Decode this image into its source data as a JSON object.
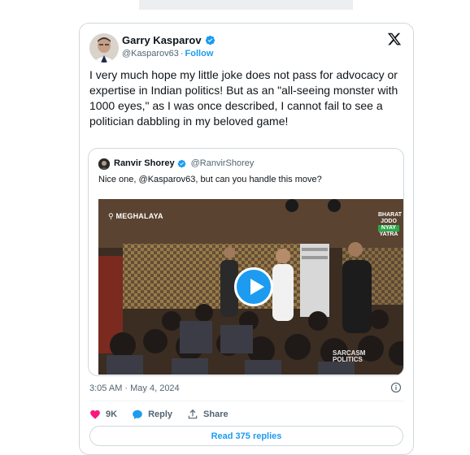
{
  "tweet": {
    "author": {
      "name": "Garry Kasparov",
      "handle": "@Kasparov63",
      "follow_label": "Follow",
      "verified_color": "#1d9bf0"
    },
    "text": "I very much hope my little joke does not pass for advocacy or expertise in Indian politics! But as an \"all-seeing monster with 1000 eyes,\" as I was once described, I cannot fail to see a politician dabbling in my beloved game!",
    "quoted": {
      "name": "Ranvir Shorey",
      "handle": "@RanvirShorey",
      "text": "Nice one, @Kasparov63, but can you handle this move?",
      "video": {
        "location_label": "MEGHALAYA",
        "overlay_lines": [
          "BHARAT",
          "JODO",
          "NYAY",
          "YATRA"
        ],
        "watermark": "SARCASM POLITICS",
        "play_icon": "play-icon"
      }
    },
    "timestamp": "3:05 AM · May 4, 2024",
    "actions": {
      "likes": "9K",
      "reply_label": "Reply",
      "share_label": "Share"
    },
    "read_replies_label": "Read 375 replies"
  },
  "colors": {
    "accent": "#1d9bf0",
    "like": "#f91880",
    "text_secondary": "#536471"
  }
}
